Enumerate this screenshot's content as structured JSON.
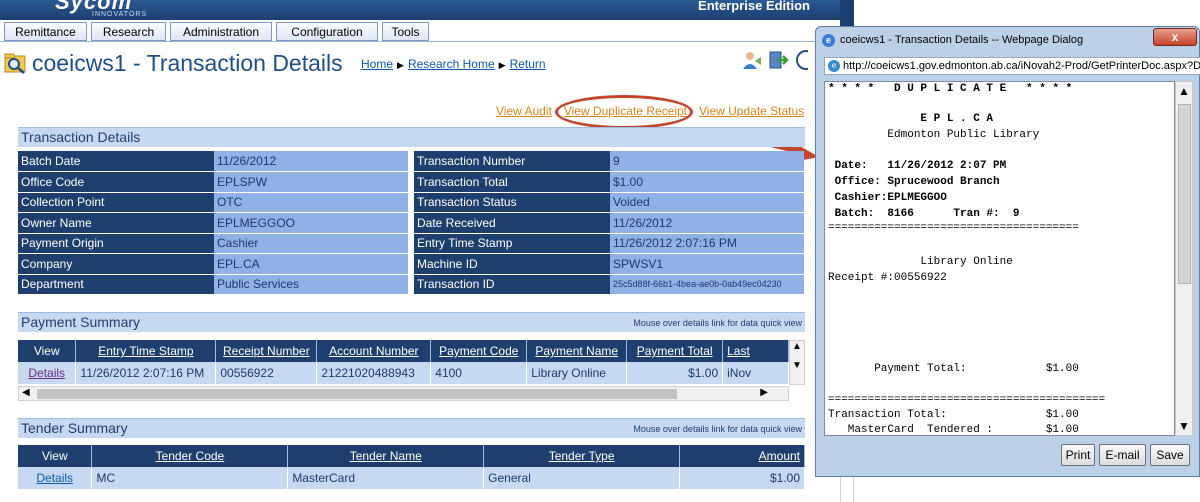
{
  "app": {
    "logo_text": "Sycom",
    "logo_sub": "INNOVATORS",
    "edition": "Enterprise Edition"
  },
  "menu": [
    {
      "label": "Remittance"
    },
    {
      "label": "Research"
    },
    {
      "label": "Administration"
    },
    {
      "label": "Configuration"
    },
    {
      "label": "Tools"
    }
  ],
  "page": {
    "title": "coeicws1 - Transaction Details",
    "breadcrumbs": [
      "Home",
      "Research Home",
      "Return"
    ]
  },
  "actions": {
    "view_audit": "View Audit",
    "view_duplicate_receipt": "View Duplicate Receipt",
    "view_update_status": "View Update Status"
  },
  "transaction_details": {
    "header": "Transaction Details",
    "left": [
      {
        "label": "Batch Date",
        "value": "11/26/2012"
      },
      {
        "label": "Office Code",
        "value": "EPLSPW"
      },
      {
        "label": "Collection Point",
        "value": "OTC"
      },
      {
        "label": "Owner Name",
        "value": "EPLMEGGOO"
      },
      {
        "label": "Payment Origin",
        "value": "Cashier"
      },
      {
        "label": "Company",
        "value": "EPL.CA"
      },
      {
        "label": "Department",
        "value": "Public Services"
      }
    ],
    "right": [
      {
        "label": "Transaction Number",
        "value": "9"
      },
      {
        "label": "Transaction Total",
        "value": "$1.00"
      },
      {
        "label": "Transaction Status",
        "value": "Voided"
      },
      {
        "label": "Date Received",
        "value": "11/26/2012"
      },
      {
        "label": "Entry Time Stamp",
        "value": "11/26/2012 2:07:16 PM"
      },
      {
        "label": "Machine ID",
        "value": "SPWSV1"
      },
      {
        "label": "Transaction ID",
        "value": "25c5d88f-66b1-4bea-ae0b-0ab49ec04230"
      }
    ]
  },
  "payment_summary": {
    "header": "Payment Summary",
    "note": "Mouse over details link for data quick view",
    "columns": [
      "View",
      "Entry Time Stamp",
      "Receipt Number",
      "Account Number",
      "Payment Code",
      "Payment Name",
      "Payment Total",
      "Last"
    ],
    "rows": [
      [
        "Details",
        "11/26/2012 2:07:16 PM",
        "00556922",
        "21221020488943",
        "4100",
        "Library Online",
        "$1.00",
        "iNov"
      ]
    ]
  },
  "tender_summary": {
    "header": "Tender Summary",
    "note": "Mouse over details link for data quick view",
    "columns": [
      "View",
      "Tender Code",
      "Tender Name",
      "Tender Type",
      "Amount"
    ],
    "rows": [
      [
        "Details",
        "MC",
        "MasterCard",
        "General",
        "$1.00"
      ]
    ]
  },
  "dialog": {
    "title": "coeicws1 - Transaction Details -- Webpage Dialog",
    "close": "x",
    "address": "http://coeicws1.gov.edmonton.ab.ca/iNovah2-Prod/GetPrinterDoc.aspx?Doc",
    "receipt_lines": [
      "* * * *   D U P L I C A T E   * * * *",
      "",
      "              E P L . C A",
      "         Edmonton Public Library",
      "",
      " Date:   11/26/2012 2:07 PM",
      " Office: Sprucewood Branch",
      " Cashier:EPLMEGGOO",
      " Batch:  8166      Tran #:  9",
      "======================================",
      "",
      "              Library Online",
      "Receipt #:00556922",
      "",
      "",
      "",
      "",
      "",
      "",
      "       Payment Total:            $1.00",
      "",
      "==========================================",
      "Transaction Total:               $1.00",
      "   MasterCard  Tendered :        $1.00"
    ],
    "buttons": [
      "Print",
      "E-mail",
      "Save"
    ]
  }
}
